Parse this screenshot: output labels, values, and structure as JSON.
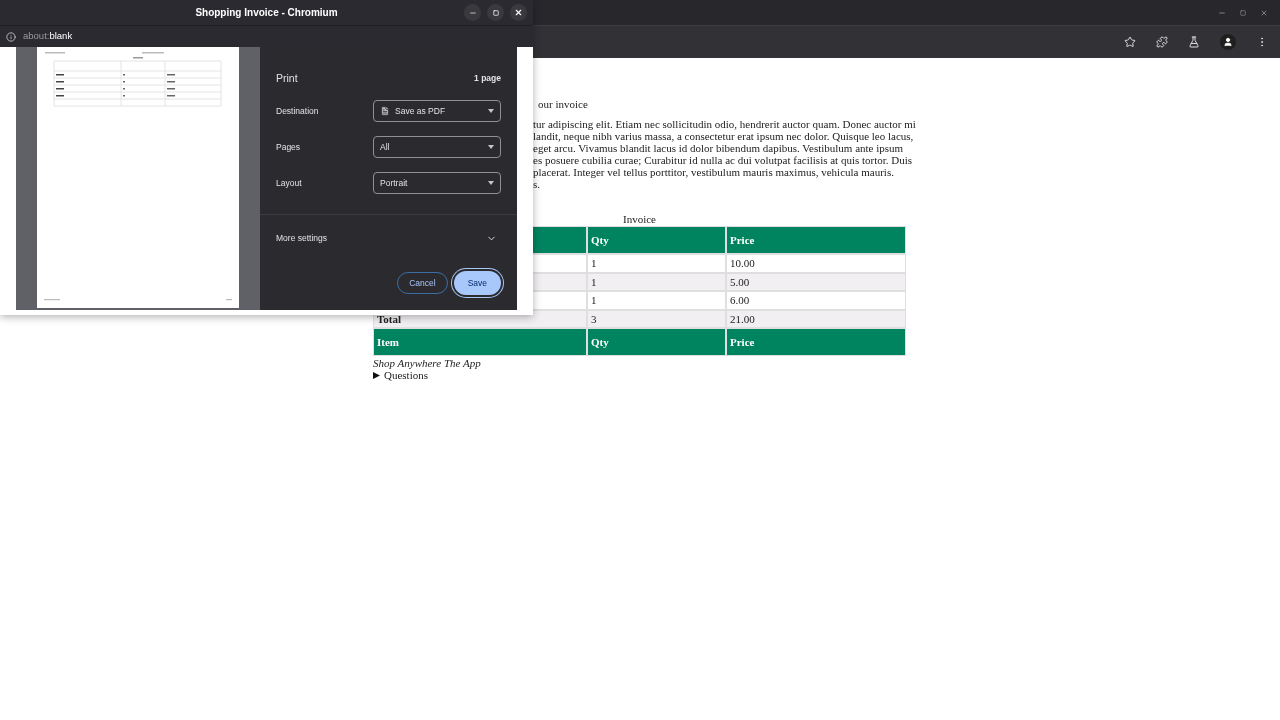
{
  "page": {
    "heading": "our invoice",
    "paragraph_lines": [
      "tur adipiscing elit. Etiam nec sollicitudin odio, hendrerit auctor quam. Donec auctor mi",
      "landit, neque nibh varius massa, a consectetur erat ipsum nec dolor. Quisque leo lacus,",
      "eget arcu. Vivamus blandit lacus id dolor bibendum dapibus. Vestibulum ante ipsum",
      "es posuere cubilia curae; Curabitur id nulla ac dui volutpat facilisis at quis tortor. Duis",
      "placerat. Integer vel tellus porttitor, vestibulum mauris maximus, vehicula mauris.",
      "s."
    ],
    "table": {
      "caption": "Invoice",
      "header": [
        "Qty",
        "Price"
      ],
      "rows": [
        {
          "kind": "item",
          "qty": "1",
          "price": "10.00"
        },
        {
          "kind": "item",
          "qty": "1",
          "price": "5.00"
        },
        {
          "kind": "item",
          "qty": "1",
          "price": "6.00"
        },
        {
          "kind": "total",
          "item": "Total",
          "qty": "3",
          "price": "21.00"
        }
      ],
      "footer": [
        "Item",
        "Qty",
        "Price"
      ]
    },
    "tagline": "Shop Anywhere The App",
    "details": {
      "summary": "Questions",
      "expanded": false
    }
  },
  "popup": {
    "title": "Shopping Invoice - Chromium",
    "url_scheme": "about:",
    "url_rest": "blank",
    "print": {
      "title": "Print",
      "page_count": "1 page",
      "settings": [
        {
          "label": "Destination",
          "value": "Save as PDF",
          "kind": "destination"
        },
        {
          "label": "Pages",
          "value": "All",
          "kind": "select"
        },
        {
          "label": "Layout",
          "value": "Portrait",
          "kind": "select"
        }
      ],
      "more_settings": {
        "label": "More settings",
        "expanded": false
      },
      "buttons": [
        {
          "label": "Cancel",
          "kind": "secondary"
        },
        {
          "label": "Save",
          "kind": "primary"
        }
      ]
    }
  }
}
